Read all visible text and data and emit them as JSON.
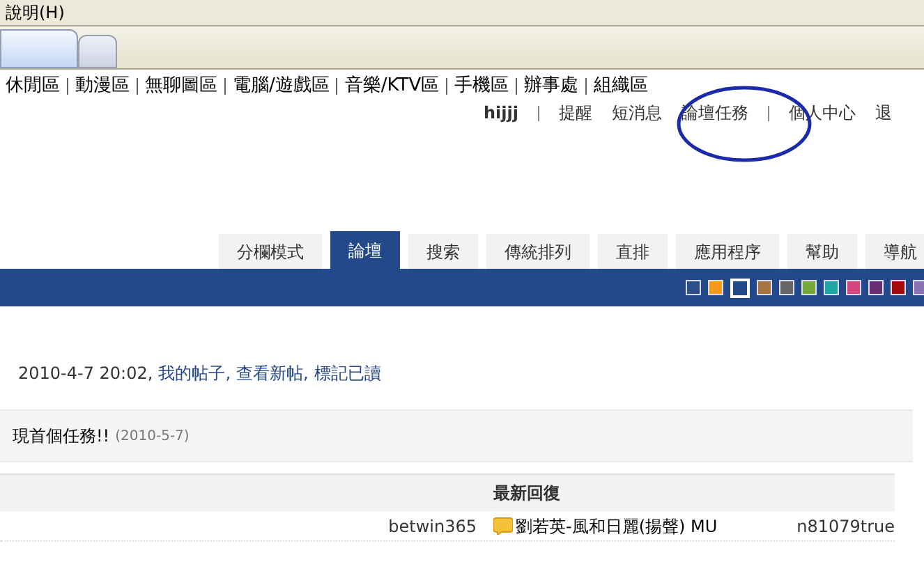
{
  "menu_bar": {
    "items": [
      "說明(H)"
    ]
  },
  "browser_tabs": [
    {
      "selected": true
    },
    {
      "selected": false
    }
  ],
  "nav_links": [
    "休閒區",
    "動漫區",
    "無聊圖區",
    "電腦/遊戲區",
    "音樂/KTV區",
    "手機區",
    "辦事處",
    "組織區"
  ],
  "user_bar": {
    "username": "hijjj",
    "links": [
      "提醒",
      "短消息",
      "論壇任務"
    ],
    "links_2": [
      "個人中心",
      "退"
    ]
  },
  "tabs": [
    {
      "label": "分欄模式",
      "selected": false
    },
    {
      "label": "論壇",
      "selected": true
    },
    {
      "label": "搜索",
      "selected": false
    },
    {
      "label": "傳統排列",
      "selected": false
    },
    {
      "label": "直排",
      "selected": false
    },
    {
      "label": "應用程序",
      "selected": false
    },
    {
      "label": "幫助",
      "selected": false
    },
    {
      "label": "導航",
      "selected": false
    }
  ],
  "themes": [
    {
      "color": "#2b4f8a",
      "selected": false
    },
    {
      "color": "#f39a1d",
      "selected": false
    },
    {
      "color": "#24498a",
      "selected": true
    },
    {
      "color": "#a67442",
      "selected": false
    },
    {
      "color": "#666666",
      "selected": false
    },
    {
      "color": "#77a83a",
      "selected": false
    },
    {
      "color": "#1fa6a6",
      "selected": false
    },
    {
      "color": "#d2457d",
      "selected": false
    },
    {
      "color": "#6a2d77",
      "selected": false
    },
    {
      "color": "#a30b0b",
      "selected": false
    },
    {
      "color": "#8a6fb5",
      "selected": false
    }
  ],
  "last_visit": {
    "text": "2010-4-7 20:02,",
    "links": [
      "我的帖子,",
      "查看新帖,",
      "標記已讀"
    ]
  },
  "notice": {
    "text": "現首個任務!!",
    "date": "(2010-5-7)"
  },
  "table": {
    "header": "最新回復",
    "rows": [
      {
        "author": "betwin365",
        "title": "劉若英-風和日麗(揚聲) MU",
        "last_poster": "n81079true"
      }
    ]
  }
}
